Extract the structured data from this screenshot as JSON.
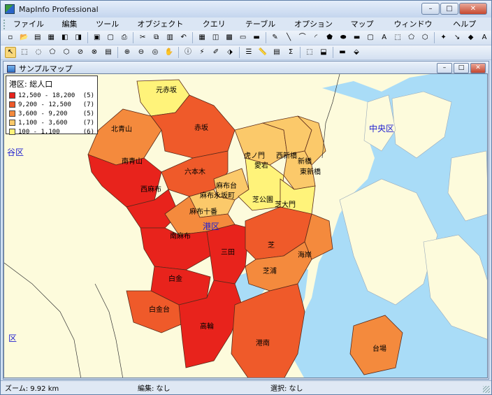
{
  "app": {
    "title": "MapInfo Professional"
  },
  "menu": [
    "ファイル(F)",
    "編集(E)",
    "ツール(T)",
    "オブジェクト(O)",
    "クエリ(Q)",
    "テーブル(A)",
    "オプション(P)",
    "マップ(M)",
    "ウィンドウ(W)",
    "ヘルプ(H)"
  ],
  "window_controls": {
    "minimize": "–",
    "maximize": "□",
    "close": "✕"
  },
  "map_window": {
    "title": "サンプルマップ"
  },
  "legend": {
    "title": "港区: 総人口",
    "rows": [
      {
        "range": "12,500 - 18,200",
        "count": "(5)",
        "color": "#e8231c"
      },
      {
        "range": " 9,200 - 12,500",
        "count": "(7)",
        "color": "#ef5a2a"
      },
      {
        "range": " 3,600 -  9,200",
        "count": "(5)",
        "color": "#f48a3d"
      },
      {
        "range": " 1,100 -  3,600",
        "count": "(7)",
        "color": "#fbc96a"
      },
      {
        "range": "   100 -  1,100",
        "count": "(6)",
        "color": "#fff37a"
      }
    ]
  },
  "map_labels": {
    "moto_akasaka": "元赤坂",
    "kita_aoyama": "北青山",
    "akasaka": "赤坂",
    "minami_aoyama": "南青山",
    "toranomon": "虎ノ門",
    "atago": "愛宕",
    "nishi_shinbashi": "西新橋",
    "shinbashi": "新橋",
    "higashi_shinbashi": "東新橋",
    "roppongi": "六本木",
    "nishi_azabu": "西麻布",
    "azabudai": "麻布台",
    "azabu_nagasaka": "麻布永坂町",
    "shiba_koen": "芝公園",
    "shiba_daimon": "芝大門",
    "azabu_juban": "麻布十番",
    "minato_ku": "港区",
    "minami_azabu": "南麻布",
    "mita": "三田",
    "shiba": "芝",
    "kaigan": "海岸",
    "shibaura": "芝浦",
    "shirokane": "白金",
    "shirokanedai": "白金台",
    "takanawa": "高輪",
    "konan": "港南",
    "daiba": "台場",
    "chuo_ku": "中央区",
    "shibuya_ku_partial": "谷区",
    "shinagawa_partial": "区"
  },
  "status": {
    "zoom": "ズーム: 9.92 km",
    "edit": "編集: なし",
    "select": "選択: なし"
  }
}
